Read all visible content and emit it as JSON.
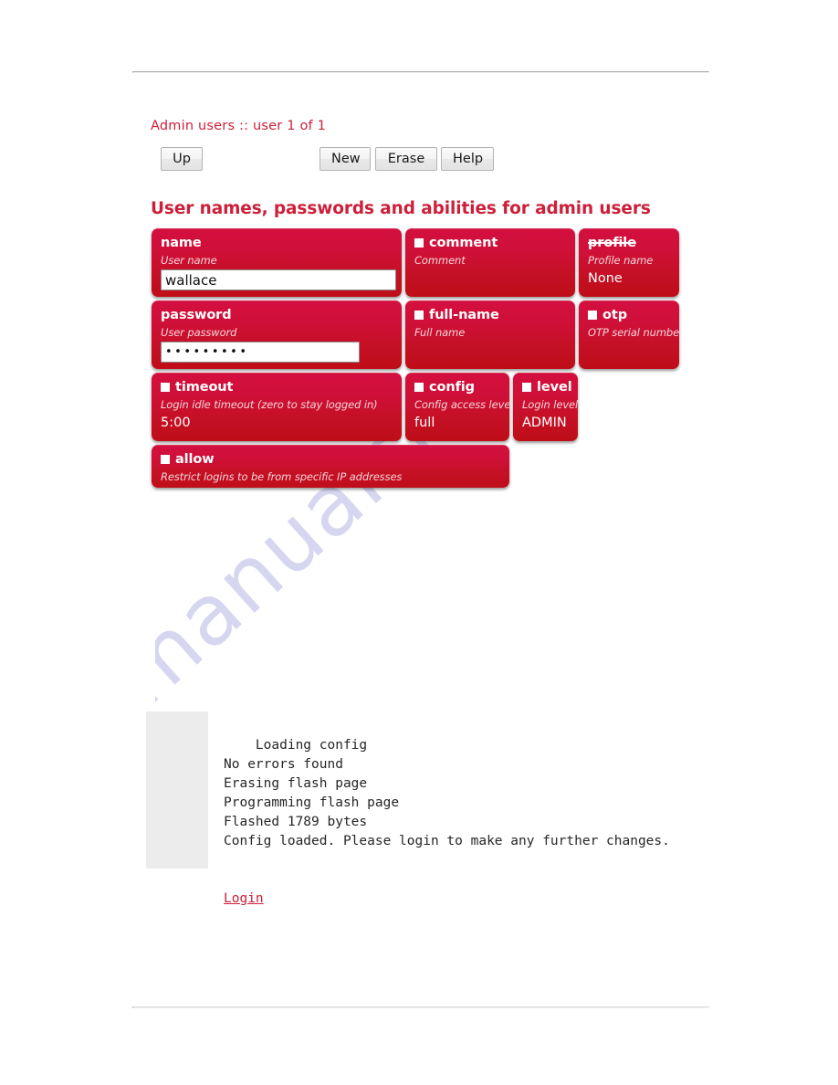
{
  "breadcrumb": "Admin users :: user 1 of 1",
  "toolbar": {
    "up_label": "Up",
    "new_label": "New",
    "erase_label": "Erase",
    "help_label": "Help"
  },
  "section": {
    "title": "User names, passwords and abilities for admin users"
  },
  "colors": {
    "accent_red": "#cc1f39",
    "card_top": "#d30f3f",
    "card_bottom": "#bf0e18",
    "hint_text": "#f6d4d9",
    "watermark": "#c9c9ec",
    "greybox": "#ececec"
  },
  "cards": [
    {
      "name": "name",
      "title": "name",
      "hint": "User name",
      "checkbox": false,
      "struck": false,
      "input": {
        "type": "text",
        "value": "wallace",
        "placeholder": ""
      }
    },
    {
      "name": "comment",
      "title": "comment",
      "hint": "Comment",
      "checkbox": true,
      "struck": false,
      "value": ""
    },
    {
      "name": "profile",
      "title": "profile",
      "hint": "Profile name",
      "checkbox": false,
      "struck": true,
      "value": "None"
    },
    {
      "name": "password",
      "title": "password",
      "hint": "User password",
      "checkbox": false,
      "struck": false,
      "input": {
        "type": "password",
        "value": "•••••••••",
        "placeholder": ""
      }
    },
    {
      "name": "full-name",
      "title": "full-name",
      "hint": "Full name",
      "checkbox": true,
      "struck": false,
      "value": ""
    },
    {
      "name": "otp",
      "title": "otp",
      "hint": "OTP serial number",
      "checkbox": true,
      "struck": false,
      "value": ""
    },
    {
      "name": "timeout",
      "title": "timeout",
      "hint": "Login idle timeout (zero to stay logged in)",
      "checkbox": true,
      "struck": false,
      "value": "5:00"
    },
    {
      "name": "config",
      "title": "config",
      "hint": "Config access level",
      "checkbox": true,
      "struck": false,
      "value": "full"
    },
    {
      "name": "level",
      "title": "level",
      "hint": "Login level",
      "checkbox": true,
      "struck": false,
      "value": "ADMIN"
    },
    {
      "name": "allow",
      "title": "allow",
      "hint": "Restrict logins to be from specific IP addresses",
      "checkbox": true,
      "struck": false,
      "value": ""
    }
  ],
  "console": {
    "lines": [
      "Loading config",
      "No errors found",
      "Erasing flash page",
      "Programming flash page",
      "Flashed 1789 bytes",
      "Config loaded. Please login to make any further changes."
    ],
    "text": "Loading config\nNo errors found\nErasing flash page\nProgramming flash page\nFlashed 1789 bytes\nConfig loaded. Please login to make any further changes.",
    "login_label": "Login"
  },
  "watermark": {
    "text": "manualshive.com"
  }
}
